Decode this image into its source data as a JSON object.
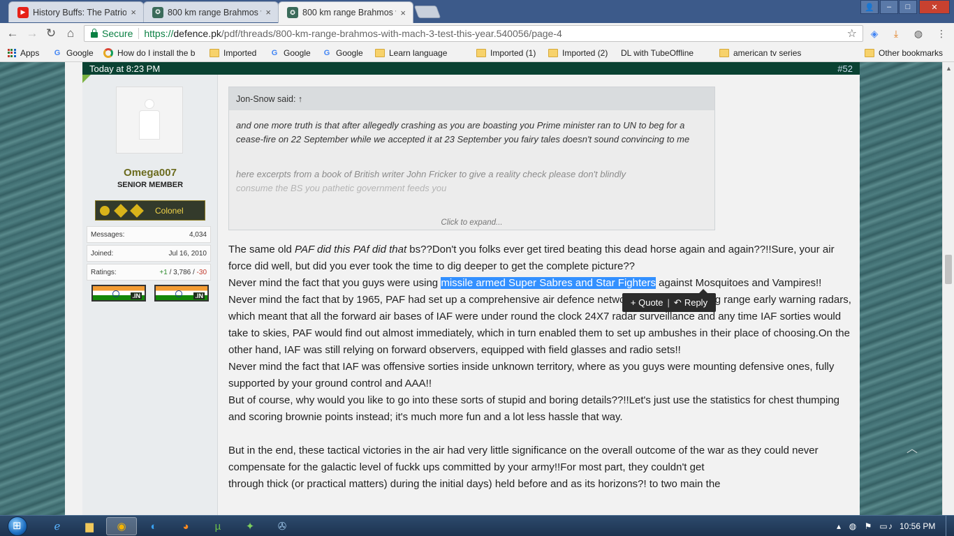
{
  "tabs": [
    {
      "title": "History Buffs: The Patriot",
      "icon": "youtube-icon",
      "color": "#e62117"
    },
    {
      "title": "800 km range Brahmos w",
      "icon": "defence-pk-icon",
      "color": "#3b6b5a"
    },
    {
      "title": "800 km range Brahmos w",
      "icon": "defence-pk-icon",
      "color": "#3b6b5a",
      "active": true
    }
  ],
  "address": {
    "secure_label": "Secure",
    "scheme": "https://",
    "host": "defence.pk",
    "path": "/pdf/threads/800-km-range-brahmos-with-mach-3-test-this-year.540056/page-4"
  },
  "bookmarks": [
    {
      "label": "Apps",
      "icon": "apps"
    },
    {
      "label": "Google",
      "icon": "g"
    },
    {
      "label": "How do I install the b",
      "icon": "circle"
    },
    {
      "label": "Imported",
      "icon": "folder"
    },
    {
      "label": "Google",
      "icon": "g"
    },
    {
      "label": "Google",
      "icon": "g"
    },
    {
      "label": "Learn language",
      "icon": "folder"
    },
    {
      "label": "",
      "icon": "page"
    },
    {
      "label": "Imported (1)",
      "icon": "folder"
    },
    {
      "label": "Imported (2)",
      "icon": "folder"
    },
    {
      "label": "DL with TubeOffline",
      "icon": "page"
    },
    {
      "label": "american tv series",
      "icon": "folder"
    },
    {
      "label": "Other bookmarks",
      "icon": "folder"
    }
  ],
  "post": {
    "timestamp": "Today at 8:23 PM",
    "number": "#52"
  },
  "user": {
    "name": "Omega007",
    "title": "SENIOR MEMBER",
    "rank": "Colonel",
    "stats": {
      "messages_label": "Messages:",
      "messages": "4,034",
      "joined_label": "Joined:",
      "joined": "Jul 16, 2010",
      "ratings_label": "Ratings:",
      "ratings_pos": "+1",
      "ratings_sep": " / ",
      "ratings_total": "3,786",
      "ratings_neg": "-30"
    },
    "flag_tld": ".IN"
  },
  "quote": {
    "header": "Jon-Snow said: ↑",
    "text": "and one more truth is that after allegedly crashing as you are boasting you Prime minister ran to UN to beg for a cease-fire on 22 September while we accepted it at 23 September you fairy tales doesn't sound convincing to me",
    "fade1": "here excerpts from a book of British writer John Fricker to give a reality check please don't blindly",
    "fade2": "consume the BS you pathetic government feeds you",
    "expand": "Click to expand..."
  },
  "message": {
    "p1_a": "The same old ",
    "p1_em": "PAF did this PAf did that",
    "p1_b": " bs??Don't you folks ever get tired beating this dead horse again and again??!!Sure, your air force did well, but did you ever took the time to dig deeper to get the complete picture??",
    "p2_a": "Never mind the fact that you guys were using ",
    "p2_hl": "missile armed Super Sabres and Star Fighters",
    "p2_b": " against Mosquitoes and Vampires!!",
    "p3": "Never mind the fact that by 1965, PAF had set up a comprehensive air defence network, consisting of long range early warning radars, which meant that all the forward air bases of IAF were under round the clock 24X7 radar surveillance and any time IAF sorties would take to skies, PAF would find out almost immediately, which in turn enabled them to set up ambushes in their place of choosing.On the other hand, IAF was still relying on forward observers, equipped with field glasses and radio sets!!",
    "p4": "Never mind the fact that IAF was offensive sorties inside unknown territory, where as you guys were mounting defensive ones, fully supported by your ground control and AAA!!",
    "p5": "But of course, why would you like to go into these sorts of stupid and boring details??!!Let's just use the statistics for chest thumping and scoring brownie points instead; it's much more fun and a lot less hassle that way.",
    "p6": "But in the end, these tactical victories in the air had very little significance on the overall outcome of the war as they could never compensate for the galactic level of fuckk ups committed by your army!!For most part, they couldn't get",
    "p7": "through thick (or practical matters) during the initial days) held before and as its horizons?! to two main the"
  },
  "quote_reply": {
    "quote_label": "+ Quote",
    "divider": "|",
    "reply_label": "Reply"
  },
  "taskbar": {
    "clock": "10:56 PM"
  }
}
